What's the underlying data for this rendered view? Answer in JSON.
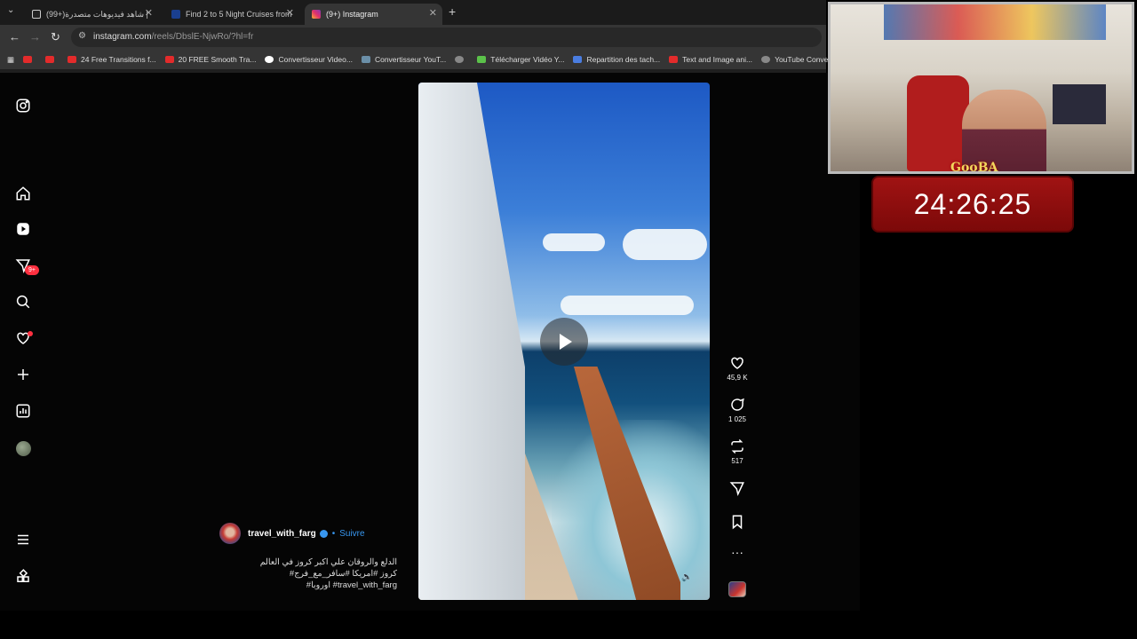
{
  "tabs": [
    {
      "label": "(99+)شاهد فيديوهات متصدرة |",
      "favicon": "tiktok-icon"
    },
    {
      "label": "Find 2 to 5 Night Cruises from",
      "favicon": "cruise-icon"
    },
    {
      "label": "(9+) Instagram",
      "favicon": "instagram-icon",
      "active": true
    }
  ],
  "address": {
    "host": "instagram.com",
    "path": "/reels/DbslE-NjwRo/?hl=fr"
  },
  "bookmarks": [
    {
      "label": "",
      "icon": "youtube-icon"
    },
    {
      "label": "",
      "icon": "youtube-icon"
    },
    {
      "label": "24 Free Transitions f...",
      "icon": "youtube-icon"
    },
    {
      "label": "20 FREE Smooth Tra...",
      "icon": "youtube-icon"
    },
    {
      "label": "Convertisseur Video...",
      "icon": "google-icon"
    },
    {
      "label": "Convertisseur YouT...",
      "icon": "site-icon"
    },
    {
      "label": "",
      "icon": "globe-icon"
    },
    {
      "label": "Télécharger Vidéo Y...",
      "icon": "download-icon"
    },
    {
      "label": "Repartition des tach...",
      "icon": "docs-icon"
    },
    {
      "label": "Text and Image ani...",
      "icon": "youtube-icon"
    },
    {
      "label": "YouTube Converter...",
      "icon": "globe-icon"
    }
  ],
  "sidebar": {
    "messages_badge": "9+"
  },
  "reel": {
    "likes": "45,9 K",
    "comments": "1 025",
    "reposts": "517",
    "author": "travel_with_farg",
    "follow": "Suivre",
    "separator": "•",
    "caption_line1": "الدلع والروقان علي اكبر كروز في العالم",
    "caption_line2": "#كروز #امريكا #سافر_مع_فرج",
    "caption_line3": "#اوروبا #travel_with_farg"
  },
  "overlay": {
    "timer": "24:26:25",
    "channel_logo": "GooBA"
  }
}
